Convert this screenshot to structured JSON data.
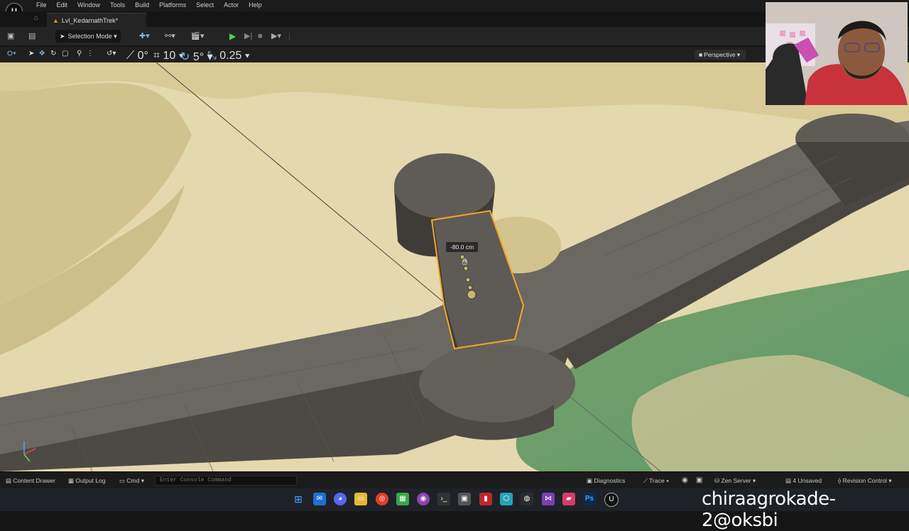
{
  "app": {
    "logo_text": "U"
  },
  "menu": [
    "File",
    "Edit",
    "Window",
    "Tools",
    "Build",
    "Platforms",
    "Select",
    "Actor",
    "Help"
  ],
  "tab": {
    "title": "Lvl_KedarnathTrek*"
  },
  "toolbar": {
    "selection_mode": "Selection Mode"
  },
  "viewport_toolbar": {
    "rotation_snap": "0°",
    "grid_snap": "10",
    "angle_snap": "5°",
    "scale_snap": "0.25",
    "view_mode": "Perspective"
  },
  "viewport": {
    "measure_label": "-80.0 cm"
  },
  "statusbar": {
    "content_drawer": "Content Drawer",
    "output_log": "Output Log",
    "cmd": "Cmd",
    "console_placeholder": "Enter Console Command",
    "diagnostics": "Diagnostics",
    "trace": "Trace",
    "zen_server": "Zen Server",
    "unsaved": "4 Unsaved",
    "revision_control": "Revision Control"
  },
  "overlay": {
    "text": "chiraagrokade-2@oksbi"
  },
  "colors": {
    "selection": "#f5a623",
    "play": "#4fd04f",
    "sand": "#ddd1a6",
    "road": "#5f5c56"
  }
}
